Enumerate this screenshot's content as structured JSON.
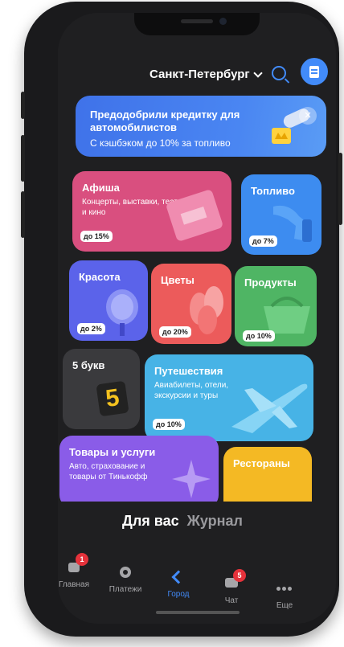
{
  "header": {
    "city": "Санкт-Петербург",
    "search_icon": "search-icon",
    "profile_icon": "documents-icon",
    "accent": "#428bf9"
  },
  "banner": {
    "title": "Предодобрили кредитку для автомобилистов",
    "subtitle": "С кэшбэком до 10% за топливо",
    "close": "×"
  },
  "tiles": {
    "afisha": {
      "title": "Афиша",
      "desc": "Концерты, выставки, театр и кино",
      "badge": "до 15%",
      "color": "#d94f7f"
    },
    "fuel": {
      "title": "Топливо",
      "badge": "до 7%",
      "color": "#3d8cf0"
    },
    "beauty": {
      "title": "Красота",
      "badge": "до 2%",
      "color": "#5b63ea"
    },
    "flowers": {
      "title": "Цветы",
      "badge": "до 20%",
      "color": "#ec5b5b"
    },
    "products": {
      "title": "Продукты",
      "badge": "до 10%",
      "color": "#4fb564"
    },
    "five": {
      "title": "5 букв",
      "digit": "5",
      "color": "#3a3a3d"
    },
    "travel": {
      "title": "Путешествия",
      "desc": "Авиабилеты, отели, экскурсии и туры",
      "badge": "до 10%",
      "color": "#47b3e6"
    },
    "goods": {
      "title": "Товары и услуги",
      "desc": "Авто, страхование и товары от Тинькофф",
      "color": "#8a5ce8"
    },
    "restaurants": {
      "title": "Рестораны",
      "color": "#f4b924"
    }
  },
  "tabs": {
    "active": "Для вас",
    "inactive": "Журнал"
  },
  "nav": {
    "items": [
      {
        "label": "Главная",
        "icon": "home-icon",
        "badge": "1"
      },
      {
        "label": "Платежи",
        "icon": "payments-icon"
      },
      {
        "label": "Город",
        "icon": "city-icon"
      },
      {
        "label": "Чат",
        "icon": "chat-icon",
        "badge": "5"
      },
      {
        "label": "Еще",
        "icon": "more-icon"
      }
    ],
    "active_color": "#428bf9"
  }
}
